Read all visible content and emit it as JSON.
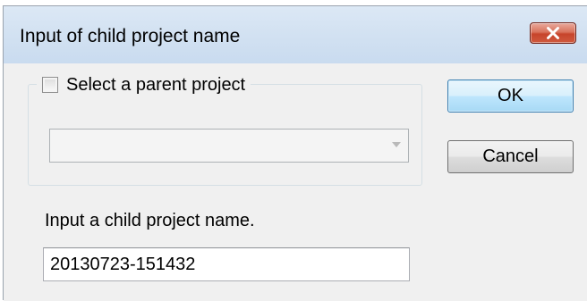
{
  "window": {
    "title": "Input of child project name",
    "close_icon": "close-x-icon"
  },
  "parent_group": {
    "checkbox_label": "Select a parent project",
    "checkbox_checked": false,
    "combo_value": "",
    "combo_enabled": false,
    "combo_arrow_icon": "chevron-down-icon"
  },
  "buttons": {
    "ok_label": "OK",
    "cancel_label": "Cancel"
  },
  "child_name": {
    "label": "Input a child project name.",
    "value": "20130723-151432"
  },
  "colors": {
    "title_bar": "#d3e2f2",
    "close_button": "#c7442b",
    "dialog_background": "#f0f0f0",
    "ok_button": "#bee6fd"
  }
}
